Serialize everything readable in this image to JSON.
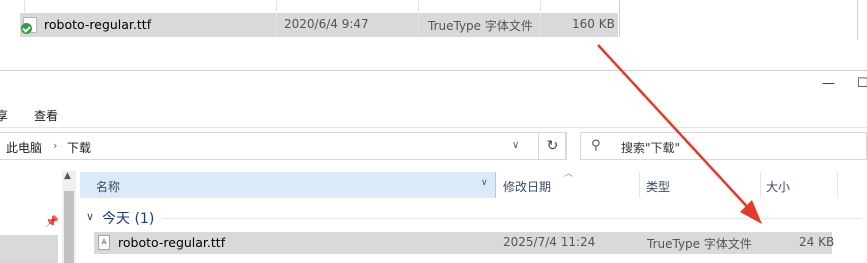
{
  "top_window": {
    "file_row": {
      "name": "roboto-regular.ttf",
      "modified": "2020/6/4 9:47",
      "type": "TrueType 字体文件",
      "size": "160 KB"
    }
  },
  "explorer": {
    "ribbon_tabs": [
      "查看"
    ],
    "ribbon_partial": "享",
    "address": {
      "crumbs": [
        "此电脑",
        "下载"
      ]
    },
    "search": {
      "placeholder": "搜索\"下载\""
    },
    "columns": {
      "name": "名称",
      "modified": "修改日期",
      "type": "类型",
      "size": "大小"
    },
    "group": {
      "title": "今天 (1)"
    },
    "file_row": {
      "name": "roboto-regular.ttf",
      "modified": "2025/7/4 11:24",
      "type": "TrueType 字体文件",
      "size": "24 KB"
    }
  },
  "colors": {
    "annotation_arrow": "#e53a28",
    "header_selected": "#d9ebf9",
    "row_selected": "#d9d9d9"
  },
  "icons": [
    "check-badge-icon",
    "font-file-icon",
    "refresh-icon",
    "search-icon",
    "pin-icon",
    "chevron-down-icon",
    "minimize-icon",
    "maximize-icon"
  ]
}
